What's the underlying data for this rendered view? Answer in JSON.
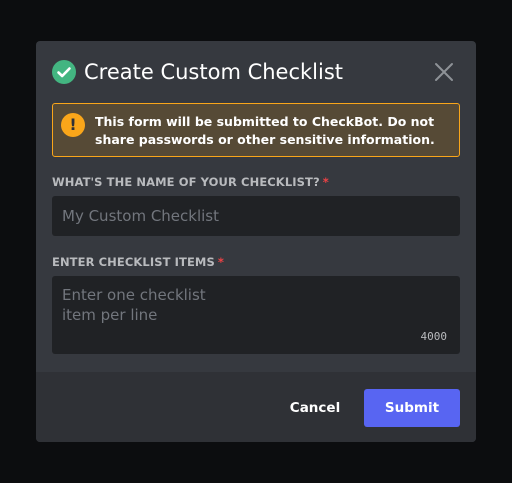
{
  "modal": {
    "title": "Create Custom Checklist",
    "notice": {
      "prefix": "This form will be submitted to ",
      "bot_name": "CheckBot",
      "suffix": ". Do not share passwords or other sensitive information."
    },
    "fields": [
      {
        "label": "WHAT'S THE NAME OF YOUR CHECKLIST?",
        "required_marker": "*",
        "placeholder": "My Custom Checklist",
        "value": ""
      },
      {
        "label": "ENTER CHECKLIST ITEMS",
        "required_marker": "*",
        "placeholder_lines": [
          "Enter one checklist",
          "item per line"
        ],
        "value": "",
        "remaining_chars": "4000"
      }
    ],
    "buttons": {
      "cancel": "Cancel",
      "submit": "Submit"
    }
  },
  "colors": {
    "backdrop": "#0c0d0f",
    "modal_bg": "#36393f",
    "footer_bg": "#2f3136",
    "input_bg": "#202225",
    "success_green": "#43b581",
    "warning_orange": "#faa61a",
    "warning_bg": "#564a36",
    "required_red": "#ed4245",
    "brand_blurple": "#5865f2"
  },
  "icons": {
    "title_icon": "check-circle-icon",
    "close_icon": "close-icon",
    "notice_icon": "warning-icon"
  }
}
